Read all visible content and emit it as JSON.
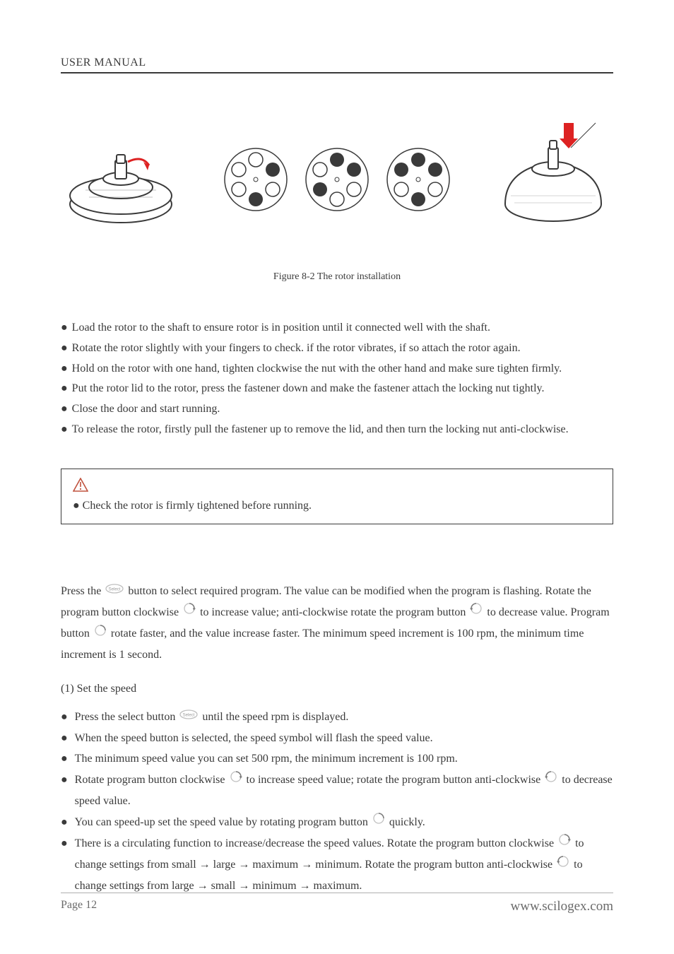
{
  "header": {
    "title": "USER MANUAL"
  },
  "figure": {
    "caption": "Figure 8-2  The rotor installation"
  },
  "bullets1": [
    "Load the rotor to the shaft to ensure rotor is in position until it connected well with the shaft.",
    "Rotate the rotor slightly with your fingers to check. if the rotor vibrates, if so attach the rotor again.",
    "Hold on the rotor with one hand, tighten clockwise the nut with the other hand and make sure tighten firmly.",
    "Put the rotor lid to the rotor, press the fastener down and make the fastener attach the locking nut tightly.",
    "Close the door and start running.",
    "To release the rotor, firstly pull the fastener up to remove the lid, and then turn the locking nut anti-clockwise."
  ],
  "warning": {
    "text": "Check the rotor is firmly tightened before running."
  },
  "intro": {
    "seg1": "Press the ",
    "seg2": " button to select required program. The value can be modified when the program is flashing. Rotate the program button clockwise ",
    "seg3": " to increase value; anti-clockwise rotate the program button ",
    "seg4": " to decrease value. Program button ",
    "seg5": " rotate faster, and the value increase faster. The minimum speed increment is 100 rpm, the minimum time increment is 1 second."
  },
  "sectionSub": "(1) Set the speed",
  "speedBullets": {
    "b1_a": "Press the select button ",
    "b1_b": " until the speed rpm is displayed.",
    "b2": "When the speed button is selected, the speed symbol will flash the speed value.",
    "b3": "The minimum speed value you can set 500 rpm, the minimum increment is 100 rpm.",
    "b4_a": "Rotate program button clockwise ",
    "b4_b": " to increase speed value; rotate the program button anti-clockwise ",
    "b4_c": " to decrease speed value.",
    "b5_a": "You can speed-up set the speed value by rotating program button ",
    "b5_b": " quickly.",
    "b6_a": "There is a circulating function to increase/decrease the speed values. Rotate the program button clockwise ",
    "b6_b": " to change settings from small → large → maximum → minimum. Rotate the program button anti-clockwise ",
    "b6_c": " to change settings from large → small → minimum → maximum."
  },
  "footer": {
    "left": "Page 12",
    "right": "www.scilogex.com"
  }
}
